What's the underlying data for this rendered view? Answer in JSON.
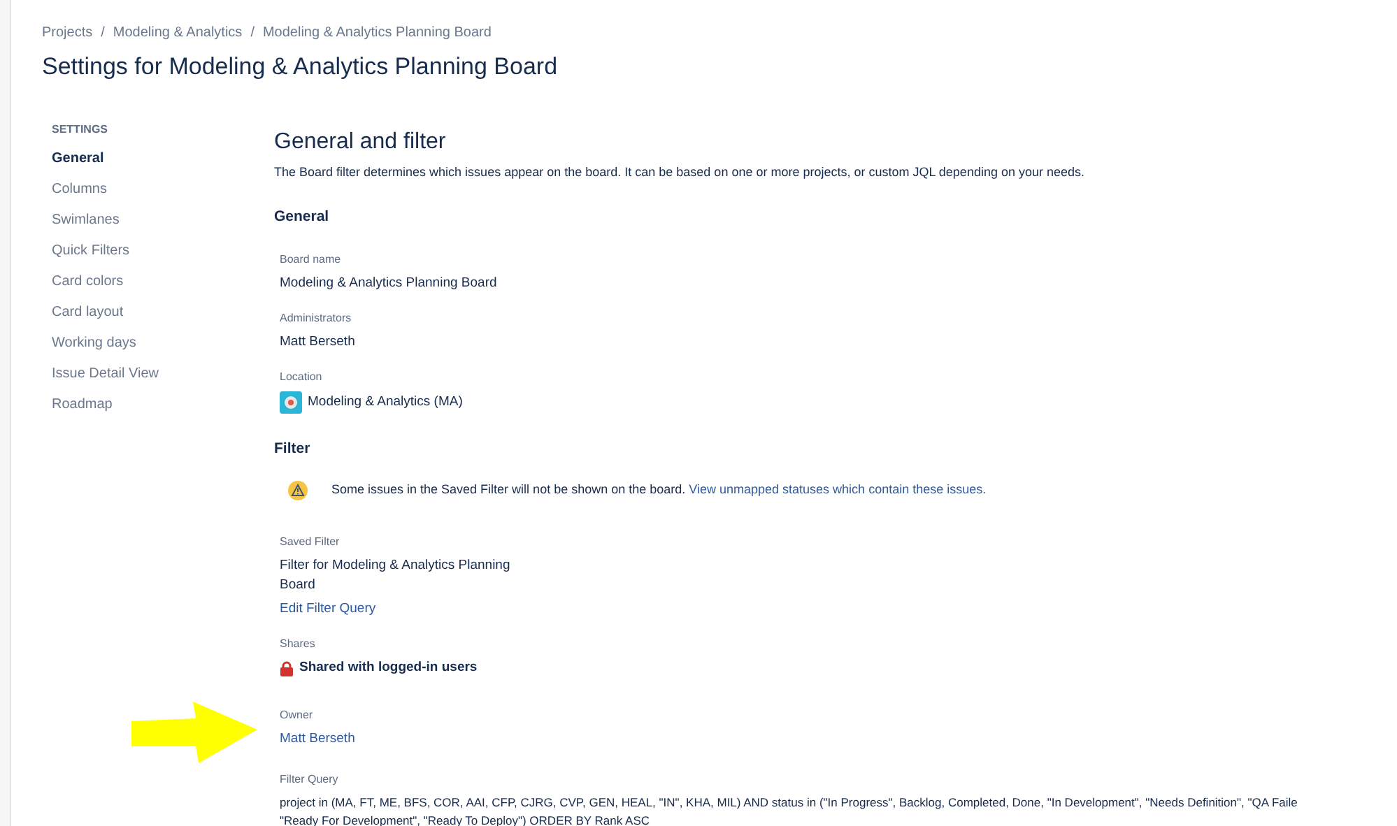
{
  "breadcrumbs": [
    "Projects",
    "Modeling & Analytics",
    "Modeling & Analytics Planning Board"
  ],
  "breadcrumb_separator": "/",
  "page_title": "Settings for Modeling & Analytics Planning Board",
  "sidebar": {
    "heading": "SETTINGS",
    "items": [
      {
        "label": "General",
        "selected": true
      },
      {
        "label": "Columns",
        "selected": false
      },
      {
        "label": "Swimlanes",
        "selected": false
      },
      {
        "label": "Quick Filters",
        "selected": false
      },
      {
        "label": "Card colors",
        "selected": false
      },
      {
        "label": "Card layout",
        "selected": false
      },
      {
        "label": "Working days",
        "selected": false
      },
      {
        "label": "Issue Detail View",
        "selected": false
      },
      {
        "label": "Roadmap",
        "selected": false
      }
    ]
  },
  "main": {
    "title": "General and filter",
    "description": "The Board filter determines which issues appear on the board. It can be based on one or more projects, or custom JQL depending on your needs.",
    "general": {
      "heading": "General",
      "fields": [
        {
          "label": "Board name",
          "value": "Modeling & Analytics Planning Board"
        },
        {
          "label": "Administrators",
          "value": "Matt Berseth"
        },
        {
          "label": "Location",
          "value": "Modeling & Analytics (MA)"
        }
      ]
    },
    "filter": {
      "heading": "Filter",
      "warning": {
        "text": "Some issues in the Saved Filter will not be shown on the board.",
        "link": "View unmapped statuses which contain these issues."
      },
      "saved_filter": {
        "label": "Saved Filter",
        "value": "Filter for Modeling & Analytics Planning Board",
        "link": "Edit Filter Query"
      },
      "shares": {
        "label": "Shares",
        "value": "Shared with logged-in users"
      },
      "owner": {
        "label": "Owner",
        "value": "Matt Berseth"
      },
      "filter_query": {
        "label": "Filter Query",
        "lines": [
          "project in (MA, FT, ME, BFS, COR, AAI, CFP, CJRG, CVP, GEN, HEAL, \"IN\", KHA, MIL) AND status in (\"In Progress\", Backlog, Completed, Done, \"In Development\", \"Needs Definition\", \"QA Faile",
          "\"Ready For Development\", \"Ready To Deploy\") ORDER BY Rank ASC"
        ]
      }
    }
  }
}
